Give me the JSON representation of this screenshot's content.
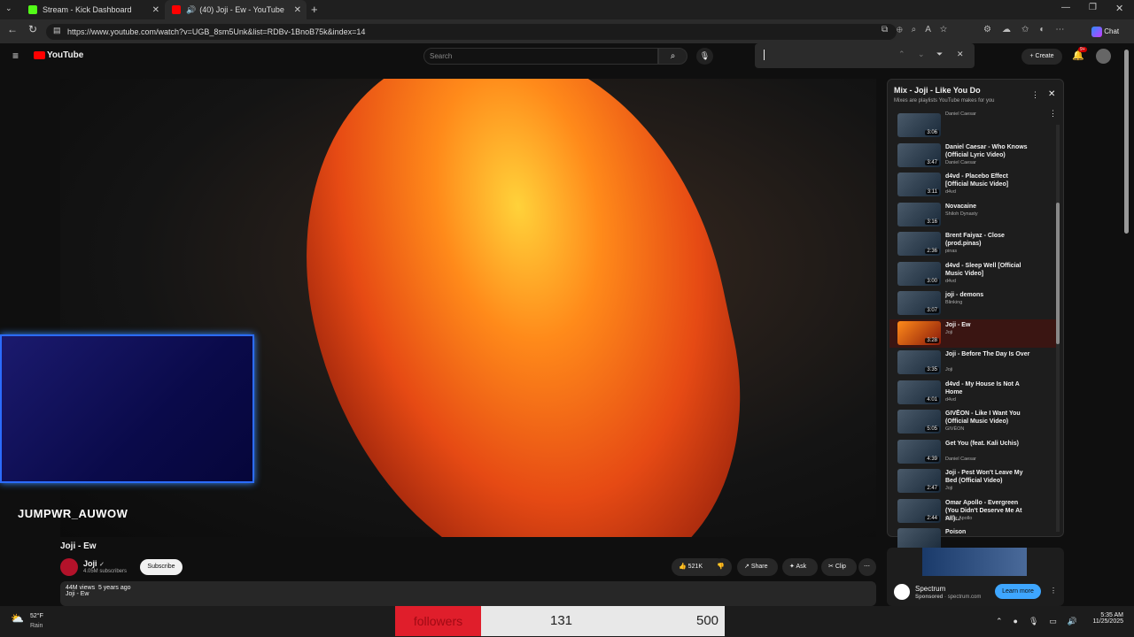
{
  "browser": {
    "tabs": [
      {
        "title": "Stream - Kick Dashboard",
        "color": "#53fc18"
      },
      {
        "title": "(40) Joji - Ew - YouTube",
        "color": "#ff0000"
      }
    ],
    "url": "https://www.youtube.com/watch?v=UGB_8sm5Unk&list=RDBv-1BnoB75k&index=14",
    "copilot": "Chat"
  },
  "youtube": {
    "logo": "YouTube",
    "search_placeholder": "Search",
    "create": "Create",
    "notif_count": "9+"
  },
  "stream": {
    "name": "JUMPWR_AUWOW"
  },
  "video": {
    "title": "Joji - Ew",
    "channel": "Joji",
    "subscribers": "4.05M subscribers",
    "subscribe": "Subscribe",
    "likes": "521K",
    "share": "Share",
    "ask": "Ask",
    "clip": "Clip",
    "views": "44M views",
    "age": "5 years ago",
    "desc_line": "Joji - Ew"
  },
  "playlist": {
    "title": "Mix - Joji - Like You Do",
    "subtitle": "Mixes are playlists YouTube makes for you",
    "items": [
      {
        "title": "",
        "channel": "Daniel Caesar",
        "dur": "3:06"
      },
      {
        "title": "Daniel Caesar - Who Knows (Official Lyric Video)",
        "channel": "Daniel Caesar",
        "dur": "3:47"
      },
      {
        "title": "d4vd - Placebo Effect [Official Music Video]",
        "channel": "d4vd",
        "dur": "3:11"
      },
      {
        "title": "Novacaine",
        "channel": "Shiloh Dynasty",
        "dur": "3:16"
      },
      {
        "title": "Brent Faiyaz - Close (prod.pinas)",
        "channel": "pinas",
        "dur": "2:36"
      },
      {
        "title": "d4vd - Sleep Well [Official Music Video]",
        "channel": "d4vd",
        "dur": "3:00"
      },
      {
        "title": "joji - demons",
        "channel": "Blinking",
        "dur": "3:07"
      },
      {
        "title": "Joji - Ew",
        "channel": "Joji",
        "dur": "3:28",
        "current": true
      },
      {
        "title": "Joji - Before The Day Is Over",
        "channel": "Joji",
        "dur": "3:35"
      },
      {
        "title": "d4vd - My House Is Not A Home",
        "channel": "d4vd",
        "dur": "4:01"
      },
      {
        "title": "GIVĒON - Like I Want You (Official Music Video)",
        "channel": "GIVĒON",
        "dur": "5:05"
      },
      {
        "title": "Get You (feat. Kali Uchis)",
        "channel": "Daniel Caesar",
        "dur": "4:39"
      },
      {
        "title": "Joji - Pest Won't Leave My Bed (Official Video)",
        "channel": "Joji",
        "dur": "2:47"
      },
      {
        "title": "Omar Apollo - Evergreen (You Didn't Deserve Me At All)...",
        "channel": "Omar Apollo",
        "dur": "2:44"
      },
      {
        "title": "Poison",
        "channel": "",
        "dur": ""
      }
    ]
  },
  "ad": {
    "brand": "Spectrum",
    "sponsored": "Sponsored",
    "domain": "spectrum.com",
    "cta": "Learn more"
  },
  "taskbar": {
    "temp": "52°F",
    "weather": "Rain",
    "followers_label": "followers",
    "followers_current": "131",
    "followers_goal": "500",
    "time": "5:35 AM",
    "date": "11/25/2025"
  }
}
